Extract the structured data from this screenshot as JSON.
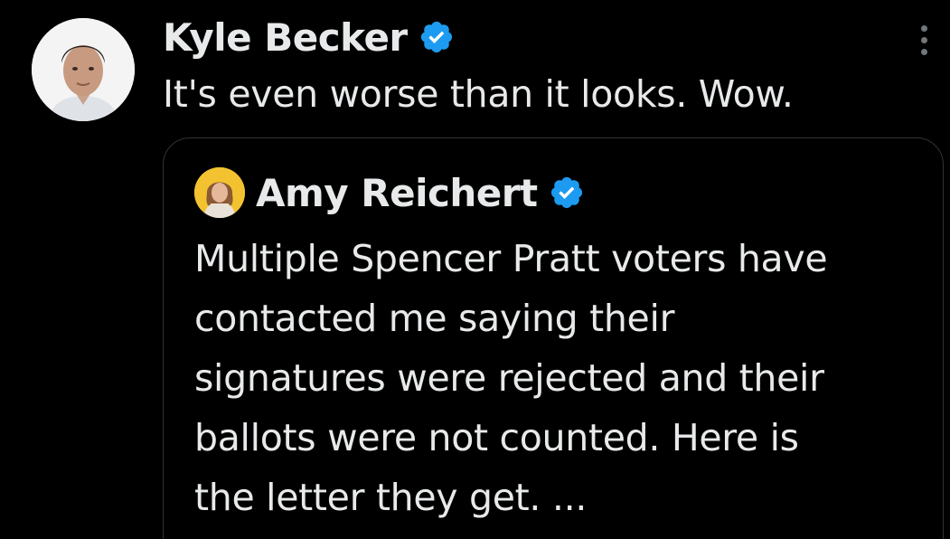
{
  "tweet": {
    "author_name": "Kyle Becker",
    "text": "It's even worse than it looks. Wow."
  },
  "quoted_tweet": {
    "author_name": "Amy Reichert",
    "text_lines": [
      "Multiple Spencer Pratt voters have",
      "contacted me saying their",
      "signatures were rejected and their",
      "ballots were not counted. Here is",
      "the letter they get. ..."
    ]
  },
  "icons": {
    "verified": "verified-badge-icon",
    "more": "more-options-icon"
  },
  "colors": {
    "background": "#000000",
    "text": "#e7e9ea",
    "verified_blue": "#1d9bf0",
    "border": "#2f3336",
    "muted": "#71767b"
  }
}
